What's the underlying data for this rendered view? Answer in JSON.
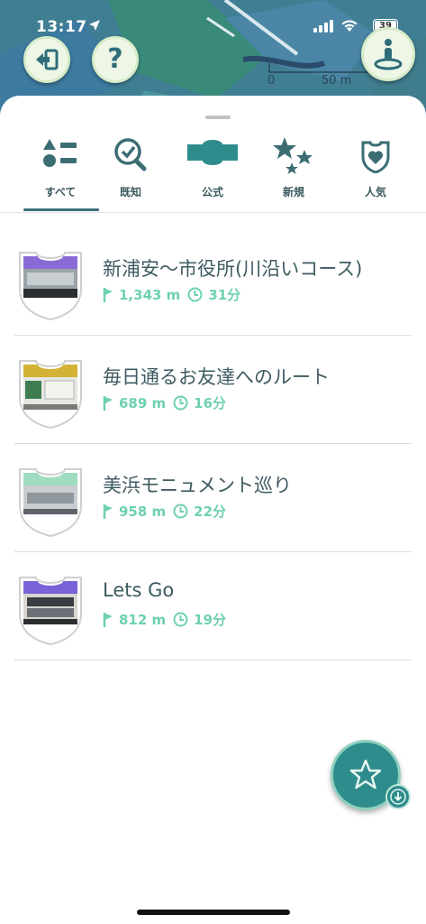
{
  "status": {
    "time": "13:17",
    "battery": "39"
  },
  "map": {
    "scale_start": "0",
    "scale_end": "50 m"
  },
  "header": {
    "help_label": "?"
  },
  "tabs": [
    {
      "label": "すべて",
      "icon": "category-shapes-icon",
      "selected": true
    },
    {
      "label": "既知",
      "icon": "search-check-icon",
      "selected": false
    },
    {
      "label": "公式",
      "icon": "route-banner-icon",
      "selected": false
    },
    {
      "label": "新規",
      "icon": "stars-icon",
      "selected": false
    },
    {
      "label": "人気",
      "icon": "heart-shield-icon",
      "selected": false
    }
  ],
  "routes": [
    {
      "title": "新浦安〜市役所(川沿いコース)",
      "distance": "1,343 m",
      "duration": "31分",
      "badge_color": "#8a6bd6"
    },
    {
      "title": "毎日通るお友達へのルート",
      "distance": "689 m",
      "duration": "16分",
      "badge_color": "#d4b236"
    },
    {
      "title": "美浜モニュメント巡り",
      "distance": "958 m",
      "duration": "22分",
      "badge_color": "#9fdcc0"
    },
    {
      "title": "Lets  Go",
      "distance": "812 m",
      "duration": "19分",
      "badge_color": "#7a63d8"
    }
  ],
  "colors": {
    "accent": "#3b6d73",
    "meta": "#6fd0b2",
    "fab": "#2e8d8c"
  }
}
